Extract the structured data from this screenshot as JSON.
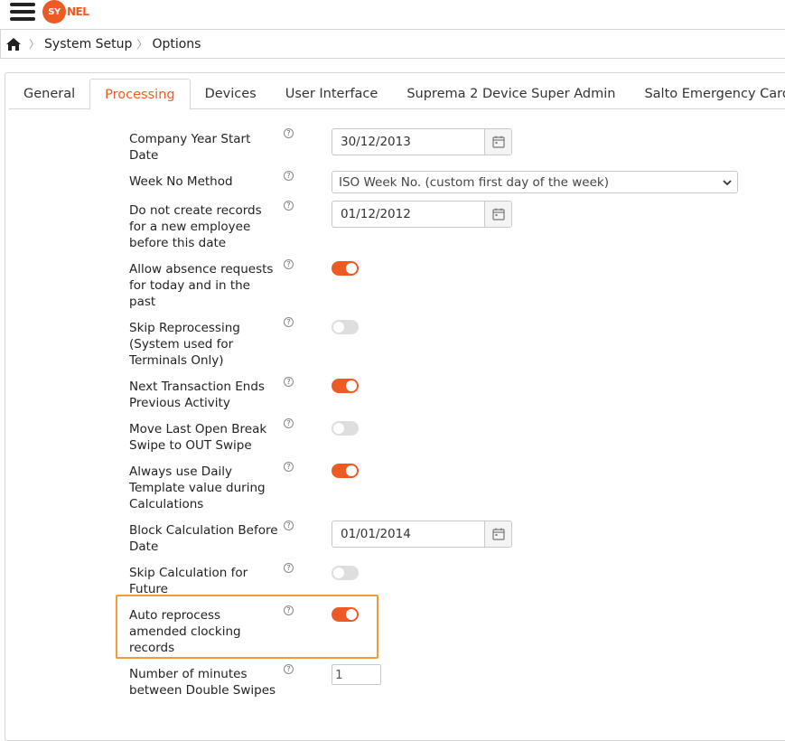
{
  "header": {
    "logo_disc": "SY",
    "logo_rest": "NEL"
  },
  "breadcrumb": {
    "items": [
      "System Setup",
      "Options"
    ]
  },
  "tabs": [
    "General",
    "Processing",
    "Devices",
    "User Interface",
    "Suprema 2 Device Super Admin",
    "Salto Emergency Cards"
  ],
  "active_tab": "Processing",
  "help_glyph": "?",
  "settings": {
    "company_year_start": {
      "label": "Company Year Start Date",
      "value": "30/12/2013"
    },
    "week_no_method": {
      "label": "Week No Method",
      "value": "ISO Week No. (custom first day of the week)"
    },
    "no_records_before": {
      "label": "Do not create records for a new employee before this date",
      "value": "01/12/2012"
    },
    "allow_absence": {
      "label": "Allow absence requests for today and in the past",
      "on": true
    },
    "skip_reprocessing": {
      "label": "Skip Reprocessing (System used for Terminals Only)",
      "on": false
    },
    "next_transaction": {
      "label": "Next Transaction Ends Previous Activity",
      "on": true
    },
    "move_last_break": {
      "label": "Move Last Open Break Swipe to OUT Swipe",
      "on": false
    },
    "daily_template": {
      "label": "Always use Daily Template value during Calculations",
      "on": true
    },
    "block_calc": {
      "label": "Block Calculation Before Date",
      "value": "01/01/2014"
    },
    "skip_calc_future": {
      "label": "Skip Calculation for Future",
      "on": false
    },
    "auto_reprocess": {
      "label": "Auto reprocess amended clocking records",
      "on": true
    },
    "double_swipes": {
      "label": "Number of minutes between Double Swipes",
      "value": "1"
    }
  },
  "colors": {
    "accent": "#ee5a24",
    "highlight": "#f39c34"
  }
}
